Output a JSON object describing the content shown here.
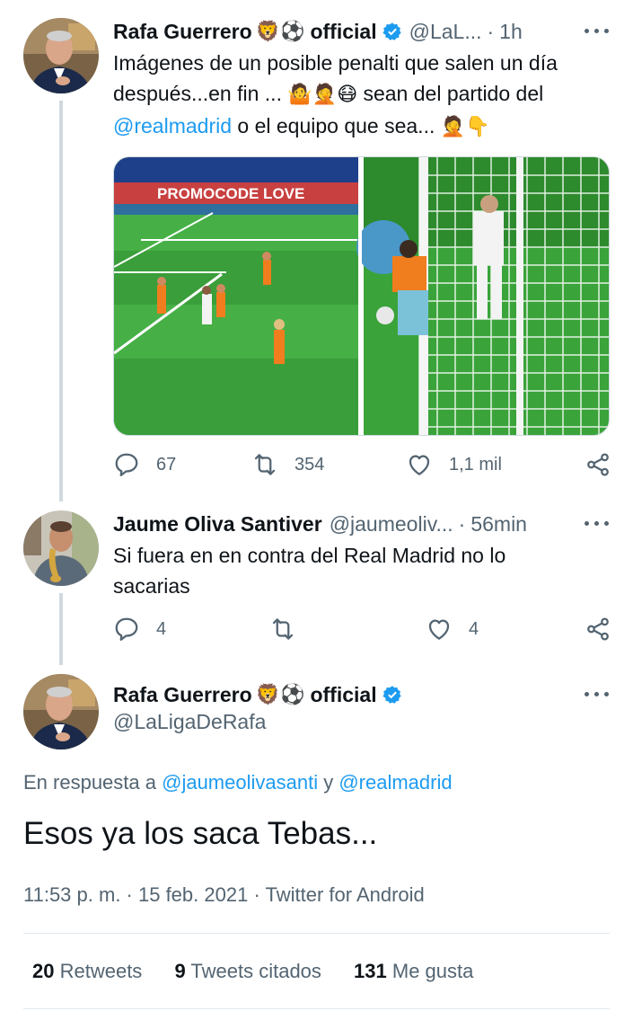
{
  "tweet1": {
    "author": "Rafa Guerrero",
    "author_emoji": "🦁⚽",
    "author_suffix": "official",
    "handle": "@LaL...",
    "separator": "·",
    "time": "1h",
    "text_line1": "Imágenes de un posible penalti que salen un día",
    "text_line2a": "después...en fin ... ",
    "text_line2_emoji": "🤷🤦😷",
    "text_line2b": " sean del partido del",
    "mention": "@realmadrid",
    "text_line3": "  o el equipo que sea... ",
    "text_line3_emoji": "🤦👇",
    "media_text": "PROMOCODE LOVE",
    "replies": "67",
    "retweets": "354",
    "likes": "1,1 mil"
  },
  "tweet2": {
    "author": "Jaume Oliva Santiver",
    "handle": "@jaumeoliv...",
    "separator": "·",
    "time": "56min",
    "text_line1": "Si fuera en en contra del Real Madrid no lo",
    "text_line2": "sacarias",
    "replies": "4",
    "likes": "4"
  },
  "tweet3": {
    "author": "Rafa Guerrero",
    "author_emoji": "🦁⚽",
    "author_suffix": "official",
    "handle": "@LaLigaDeRafa",
    "reply_prefix": "En respuesta a ",
    "reply_mention1": "@jaumeolivasanti",
    "reply_join": " y ",
    "reply_mention2": "@realmadrid",
    "text": "Esos ya los saca Tebas...",
    "timestamp": "11:53 p. m. · 15 feb. 2021",
    "sep": " · ",
    "source": "Twitter for Android",
    "retweets_count": "20",
    "retweets_label": " Retweets",
    "quotes_count": "9",
    "quotes_label": " Tweets citados",
    "likes_count": "131",
    "likes_label": " Me gusta"
  },
  "colors": {
    "accent": "#1d9bf0",
    "secondary_text": "#536471",
    "primary_text": "#0f1419"
  },
  "icons": [
    "verified-badge-icon",
    "more-icon",
    "reply-icon",
    "retweet-icon",
    "like-icon",
    "share-icon"
  ]
}
